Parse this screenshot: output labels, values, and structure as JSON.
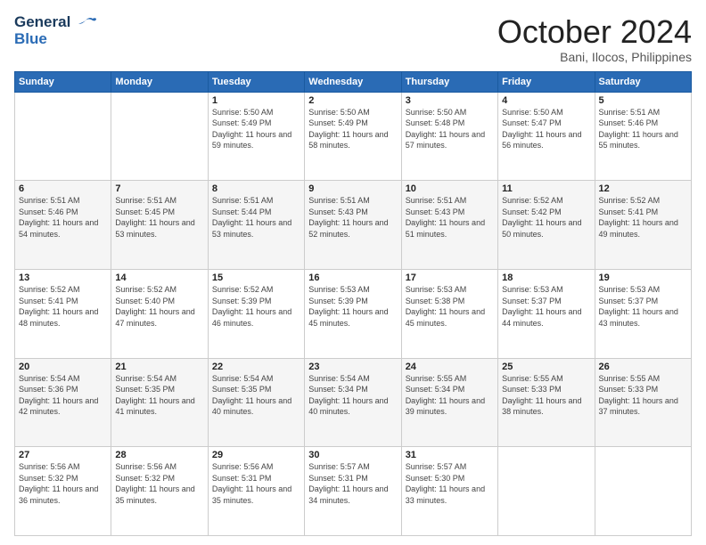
{
  "header": {
    "logo_text_general": "General",
    "logo_text_blue": "Blue",
    "month": "October 2024",
    "location": "Bani, Ilocos, Philippines"
  },
  "days_of_week": [
    "Sunday",
    "Monday",
    "Tuesday",
    "Wednesday",
    "Thursday",
    "Friday",
    "Saturday"
  ],
  "weeks": [
    [
      {
        "day": "",
        "sunrise": "",
        "sunset": "",
        "daylight": ""
      },
      {
        "day": "",
        "sunrise": "",
        "sunset": "",
        "daylight": ""
      },
      {
        "day": "1",
        "sunrise": "Sunrise: 5:50 AM",
        "sunset": "Sunset: 5:49 PM",
        "daylight": "Daylight: 11 hours and 59 minutes."
      },
      {
        "day": "2",
        "sunrise": "Sunrise: 5:50 AM",
        "sunset": "Sunset: 5:49 PM",
        "daylight": "Daylight: 11 hours and 58 minutes."
      },
      {
        "day": "3",
        "sunrise": "Sunrise: 5:50 AM",
        "sunset": "Sunset: 5:48 PM",
        "daylight": "Daylight: 11 hours and 57 minutes."
      },
      {
        "day": "4",
        "sunrise": "Sunrise: 5:50 AM",
        "sunset": "Sunset: 5:47 PM",
        "daylight": "Daylight: 11 hours and 56 minutes."
      },
      {
        "day": "5",
        "sunrise": "Sunrise: 5:51 AM",
        "sunset": "Sunset: 5:46 PM",
        "daylight": "Daylight: 11 hours and 55 minutes."
      }
    ],
    [
      {
        "day": "6",
        "sunrise": "Sunrise: 5:51 AM",
        "sunset": "Sunset: 5:46 PM",
        "daylight": "Daylight: 11 hours and 54 minutes."
      },
      {
        "day": "7",
        "sunrise": "Sunrise: 5:51 AM",
        "sunset": "Sunset: 5:45 PM",
        "daylight": "Daylight: 11 hours and 53 minutes."
      },
      {
        "day": "8",
        "sunrise": "Sunrise: 5:51 AM",
        "sunset": "Sunset: 5:44 PM",
        "daylight": "Daylight: 11 hours and 53 minutes."
      },
      {
        "day": "9",
        "sunrise": "Sunrise: 5:51 AM",
        "sunset": "Sunset: 5:43 PM",
        "daylight": "Daylight: 11 hours and 52 minutes."
      },
      {
        "day": "10",
        "sunrise": "Sunrise: 5:51 AM",
        "sunset": "Sunset: 5:43 PM",
        "daylight": "Daylight: 11 hours and 51 minutes."
      },
      {
        "day": "11",
        "sunrise": "Sunrise: 5:52 AM",
        "sunset": "Sunset: 5:42 PM",
        "daylight": "Daylight: 11 hours and 50 minutes."
      },
      {
        "day": "12",
        "sunrise": "Sunrise: 5:52 AM",
        "sunset": "Sunset: 5:41 PM",
        "daylight": "Daylight: 11 hours and 49 minutes."
      }
    ],
    [
      {
        "day": "13",
        "sunrise": "Sunrise: 5:52 AM",
        "sunset": "Sunset: 5:41 PM",
        "daylight": "Daylight: 11 hours and 48 minutes."
      },
      {
        "day": "14",
        "sunrise": "Sunrise: 5:52 AM",
        "sunset": "Sunset: 5:40 PM",
        "daylight": "Daylight: 11 hours and 47 minutes."
      },
      {
        "day": "15",
        "sunrise": "Sunrise: 5:52 AM",
        "sunset": "Sunset: 5:39 PM",
        "daylight": "Daylight: 11 hours and 46 minutes."
      },
      {
        "day": "16",
        "sunrise": "Sunrise: 5:53 AM",
        "sunset": "Sunset: 5:39 PM",
        "daylight": "Daylight: 11 hours and 45 minutes."
      },
      {
        "day": "17",
        "sunrise": "Sunrise: 5:53 AM",
        "sunset": "Sunset: 5:38 PM",
        "daylight": "Daylight: 11 hours and 45 minutes."
      },
      {
        "day": "18",
        "sunrise": "Sunrise: 5:53 AM",
        "sunset": "Sunset: 5:37 PM",
        "daylight": "Daylight: 11 hours and 44 minutes."
      },
      {
        "day": "19",
        "sunrise": "Sunrise: 5:53 AM",
        "sunset": "Sunset: 5:37 PM",
        "daylight": "Daylight: 11 hours and 43 minutes."
      }
    ],
    [
      {
        "day": "20",
        "sunrise": "Sunrise: 5:54 AM",
        "sunset": "Sunset: 5:36 PM",
        "daylight": "Daylight: 11 hours and 42 minutes."
      },
      {
        "day": "21",
        "sunrise": "Sunrise: 5:54 AM",
        "sunset": "Sunset: 5:35 PM",
        "daylight": "Daylight: 11 hours and 41 minutes."
      },
      {
        "day": "22",
        "sunrise": "Sunrise: 5:54 AM",
        "sunset": "Sunset: 5:35 PM",
        "daylight": "Daylight: 11 hours and 40 minutes."
      },
      {
        "day": "23",
        "sunrise": "Sunrise: 5:54 AM",
        "sunset": "Sunset: 5:34 PM",
        "daylight": "Daylight: 11 hours and 40 minutes."
      },
      {
        "day": "24",
        "sunrise": "Sunrise: 5:55 AM",
        "sunset": "Sunset: 5:34 PM",
        "daylight": "Daylight: 11 hours and 39 minutes."
      },
      {
        "day": "25",
        "sunrise": "Sunrise: 5:55 AM",
        "sunset": "Sunset: 5:33 PM",
        "daylight": "Daylight: 11 hours and 38 minutes."
      },
      {
        "day": "26",
        "sunrise": "Sunrise: 5:55 AM",
        "sunset": "Sunset: 5:33 PM",
        "daylight": "Daylight: 11 hours and 37 minutes."
      }
    ],
    [
      {
        "day": "27",
        "sunrise": "Sunrise: 5:56 AM",
        "sunset": "Sunset: 5:32 PM",
        "daylight": "Daylight: 11 hours and 36 minutes."
      },
      {
        "day": "28",
        "sunrise": "Sunrise: 5:56 AM",
        "sunset": "Sunset: 5:32 PM",
        "daylight": "Daylight: 11 hours and 35 minutes."
      },
      {
        "day": "29",
        "sunrise": "Sunrise: 5:56 AM",
        "sunset": "Sunset: 5:31 PM",
        "daylight": "Daylight: 11 hours and 35 minutes."
      },
      {
        "day": "30",
        "sunrise": "Sunrise: 5:57 AM",
        "sunset": "Sunset: 5:31 PM",
        "daylight": "Daylight: 11 hours and 34 minutes."
      },
      {
        "day": "31",
        "sunrise": "Sunrise: 5:57 AM",
        "sunset": "Sunset: 5:30 PM",
        "daylight": "Daylight: 11 hours and 33 minutes."
      },
      {
        "day": "",
        "sunrise": "",
        "sunset": "",
        "daylight": ""
      },
      {
        "day": "",
        "sunrise": "",
        "sunset": "",
        "daylight": ""
      }
    ]
  ]
}
